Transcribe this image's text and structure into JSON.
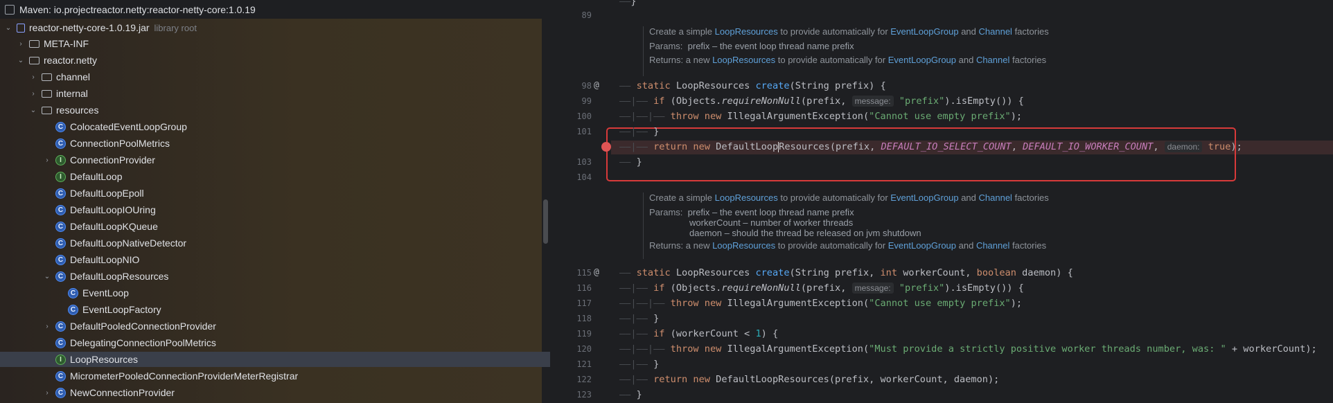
{
  "left": {
    "title": "Maven: io.projectreactor.netty:reactor-netty-core:1.0.19",
    "jar": "reactor-netty-core-1.0.19.jar",
    "jar_note": "library root",
    "tree": [
      {
        "label": "META-INF",
        "kind": "folder",
        "chev": "›"
      },
      {
        "label": "reactor.netty",
        "kind": "folder",
        "chev": "⌄"
      },
      {
        "label": "channel",
        "kind": "folder",
        "chev": "›"
      },
      {
        "label": "internal",
        "kind": "folder",
        "chev": "›"
      },
      {
        "label": "resources",
        "kind": "folder",
        "chev": "⌄"
      },
      {
        "label": "ColocatedEventLoopGroup",
        "kind": "c",
        "chev": ""
      },
      {
        "label": "ConnectionPoolMetrics",
        "kind": "c",
        "chev": ""
      },
      {
        "label": "ConnectionProvider",
        "kind": "i",
        "chev": "›"
      },
      {
        "label": "DefaultLoop",
        "kind": "i",
        "chev": ""
      },
      {
        "label": "DefaultLoopEpoll",
        "kind": "c",
        "chev": ""
      },
      {
        "label": "DefaultLoopIOUring",
        "kind": "c",
        "chev": ""
      },
      {
        "label": "DefaultLoopKQueue",
        "kind": "c",
        "chev": ""
      },
      {
        "label": "DefaultLoopNativeDetector",
        "kind": "c",
        "chev": ""
      },
      {
        "label": "DefaultLoopNIO",
        "kind": "c",
        "chev": ""
      },
      {
        "label": "DefaultLoopResources",
        "kind": "c",
        "chev": "⌄"
      },
      {
        "label": "EventLoop",
        "kind": "c",
        "chev": ""
      },
      {
        "label": "EventLoopFactory",
        "kind": "c",
        "chev": ""
      },
      {
        "label": "DefaultPooledConnectionProvider",
        "kind": "c",
        "chev": "›"
      },
      {
        "label": "DelegatingConnectionPoolMetrics",
        "kind": "c",
        "chev": ""
      },
      {
        "label": "LoopResources",
        "kind": "i",
        "chev": ""
      },
      {
        "label": "MicrometerPooledConnectionProviderMeterRegistrar",
        "kind": "c",
        "chev": ""
      },
      {
        "label": "NewConnectionProvider",
        "kind": "c",
        "chev": "›"
      }
    ]
  },
  "editor": {
    "line_numbers": [
      "89",
      "98",
      "99",
      "100",
      "101",
      "103",
      "104",
      "115",
      "116",
      "117",
      "118",
      "119",
      "120",
      "121",
      "122",
      "123"
    ],
    "doc1": {
      "summary_pre": "Create a simple ",
      "summary_link1": "LoopResources",
      "summary_mid": " to provide automatically for ",
      "summary_link2": "EventLoopGroup",
      "summary_and": " and ",
      "summary_link3": "Channel",
      "summary_post": " factories",
      "params_label": "Params:",
      "param1": "prefix – the event loop thread name prefix",
      "returns_label": "Returns:",
      "returns_pre": "a new ",
      "returns_link1": "LoopResources",
      "returns_mid": " to provide automatically for ",
      "returns_link2": "EventLoopGroup",
      "returns_and": " and ",
      "returns_link3": "Channel",
      "returns_post": " factories"
    },
    "doc2": {
      "param1": "prefix – the event loop thread name prefix",
      "param2": "workerCount – number of worker threads",
      "param3": "daemon – should the thread be released on jvm shutdown"
    },
    "hints": {
      "message": "message:",
      "daemon": "daemon:"
    },
    "strings": {
      "prefix": "\"prefix\"",
      "empty_prefix": "\"Cannot use empty prefix\"",
      "worker_msg": "\"Must provide a strictly positive worker threads number, was: \""
    }
  }
}
